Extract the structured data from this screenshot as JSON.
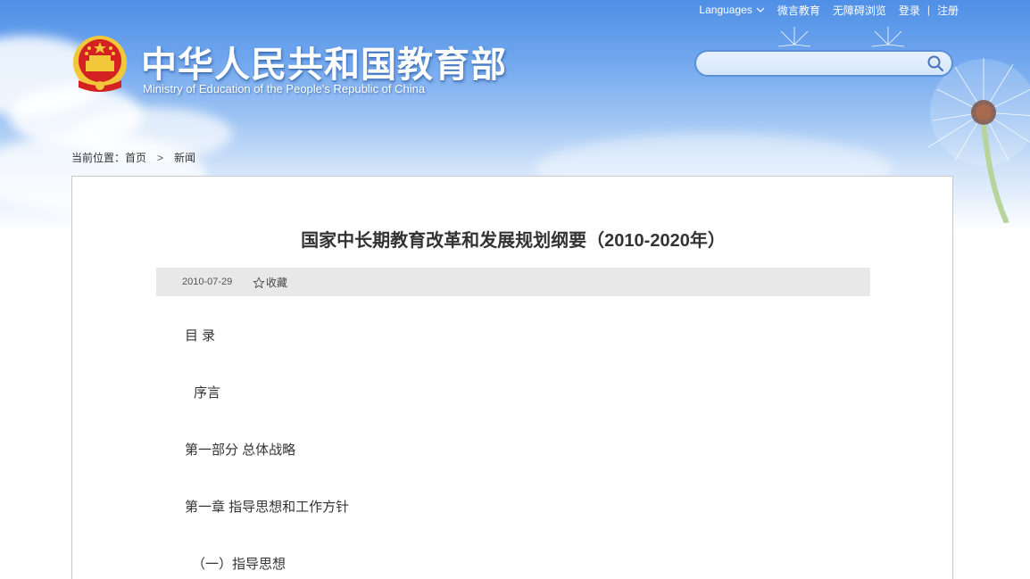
{
  "header": {
    "languages_label": "Languages",
    "links": [
      "微言教育",
      "无障碍浏览",
      "登录",
      "注册"
    ],
    "login_register_separator": "|",
    "title_cn": "中华人民共和国教育部",
    "title_en": "Ministry of Education of the People's Republic of China",
    "search": {
      "placeholder": "",
      "value": ""
    }
  },
  "breadcrumb": {
    "prefix": "当前位置：",
    "home": "首页",
    "separator": ">",
    "current": "新闻"
  },
  "article": {
    "title": "国家中长期教育改革和发展规划纲要（2010-2020年）",
    "date": "2010-07-29",
    "favorite_label": "收藏",
    "lines": [
      "目 录",
      "序言",
      "第一部分 总体战略",
      "第一章 指导思想和工作方针",
      "（一）指导思想"
    ]
  },
  "colors": {
    "sky_top": "#4f8fe6",
    "search_border": "#5b8fd6",
    "emblem_red": "#d42222",
    "emblem_gold": "#f3c73a",
    "meta_bar": "#e8e8e8"
  },
  "icons": [
    "chevron-down-icon",
    "search-icon",
    "star-icon",
    "national-emblem"
  ]
}
